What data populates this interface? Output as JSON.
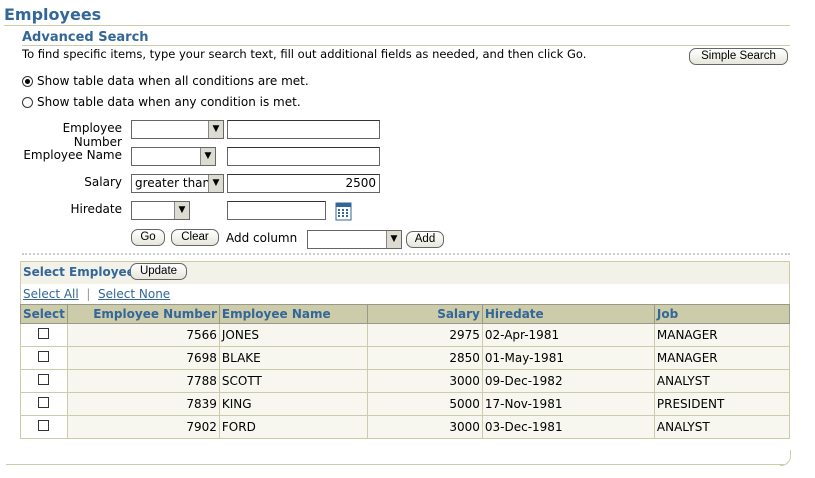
{
  "page": {
    "title": "Employees"
  },
  "search": {
    "section_title": "Advanced Search",
    "instructions": "To find specific items, type your search text, fill out additional fields as needed, and then click Go.",
    "simple_search_label": "Simple Search",
    "radio_all_label": "Show table data when all conditions are met.",
    "radio_any_label": "Show table data when any condition is met.",
    "selected_radio": "all",
    "fields": [
      {
        "label": "Employee Number",
        "operator": "",
        "value": ""
      },
      {
        "label": "Employee Name",
        "operator": "",
        "value": ""
      },
      {
        "label": "Salary",
        "operator": "greater than",
        "value": "2500"
      },
      {
        "label": "Hiredate",
        "operator": "",
        "value": ""
      }
    ],
    "go_label": "Go",
    "clear_label": "Clear",
    "add_column_label": "Add column",
    "add_column_value": "",
    "add_label": "Add"
  },
  "results": {
    "select_label": "Select Employees:",
    "update_label": "Update",
    "select_all_label": "Select All",
    "select_none_label": "Select None",
    "columns": [
      "Select",
      "Employee Number",
      "Employee Name",
      "Salary",
      "Hiredate",
      "Job"
    ],
    "rows": [
      {
        "empno": "7566",
        "name": "JONES",
        "salary": "2975",
        "hiredate": "02-Apr-1981",
        "job": "MANAGER"
      },
      {
        "empno": "7698",
        "name": "BLAKE",
        "salary": "2850",
        "hiredate": "01-May-1981",
        "job": "MANAGER"
      },
      {
        "empno": "7788",
        "name": "SCOTT",
        "salary": "3000",
        "hiredate": "09-Dec-1982",
        "job": "ANALYST"
      },
      {
        "empno": "7839",
        "name": "KING",
        "salary": "5000",
        "hiredate": "17-Nov-1981",
        "job": "PRESIDENT"
      },
      {
        "empno": "7902",
        "name": "FORD",
        "salary": "3000",
        "hiredate": "03-Dec-1981",
        "job": "ANALYST"
      }
    ]
  },
  "colors": {
    "accent": "#336699",
    "header_bg": "#ccccaa",
    "panel_bg": "#f2f2e8"
  }
}
